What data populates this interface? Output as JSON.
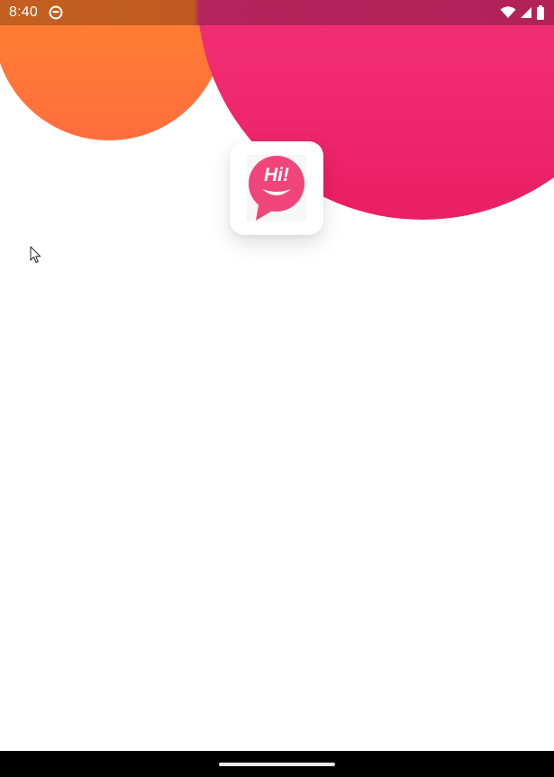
{
  "status_bar": {
    "time": "8:40",
    "app_icon": "notification-app-icon",
    "icons": [
      "wifi-icon",
      "cell-signal-icon",
      "battery-icon"
    ]
  },
  "splash": {
    "logo_text": "Hi!",
    "logo_icon": "chat-bubble-smile-icon"
  },
  "colors": {
    "orange": "#ff7a35",
    "pink": "#f02a70",
    "logo_pink": "#f0457a"
  },
  "navigation": {
    "handle": "gesture-home-handle"
  }
}
